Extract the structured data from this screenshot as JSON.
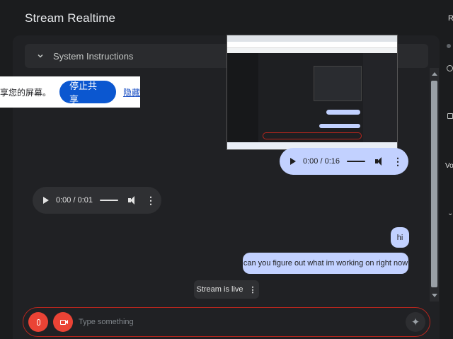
{
  "app": {
    "title": "Stream Realtime"
  },
  "system_instructions": {
    "label": "System Instructions",
    "icon": "chevron-down-icon"
  },
  "share_banner": {
    "text": "享您的屏幕。",
    "stop_button": "停止共享",
    "hide_link": "隐藏"
  },
  "messages": {
    "user_audio": {
      "time": "0:00 / 0:16"
    },
    "model_audio": {
      "time": "0:00 / 0:01"
    },
    "hi": "hi",
    "question": "can you figure out what im working on right now"
  },
  "status": {
    "label": "Stream is live",
    "more": "⋮"
  },
  "input": {
    "placeholder": "Type something",
    "mic_icon": "mic-icon",
    "video_icon": "video-icon",
    "send_icon": "sparkle-icon"
  },
  "right_sidebar": {
    "top_letter": "R",
    "middle_text": "Vo"
  },
  "colors": {
    "user_bubble": "#c2d1ff",
    "accent_red": "#ea4335",
    "share_blue": "#0b57d0"
  }
}
